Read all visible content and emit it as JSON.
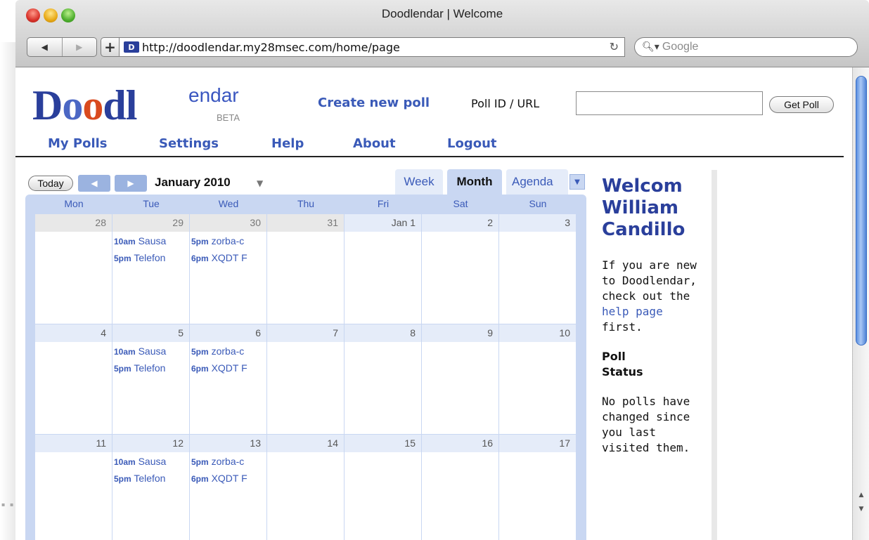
{
  "window": {
    "title": "Doodlendar | Welcome"
  },
  "toolbar": {
    "back_icon": "back-arrow-icon",
    "forward_icon": "forward-arrow-icon",
    "url": "http://doodlendar.my28msec.com/home/page",
    "search_placeholder": "Google"
  },
  "header": {
    "logo_main": "Doodl",
    "logo_small": "endar",
    "logo_beta": "BETA",
    "create_poll": "Create new poll",
    "poll_id_label": "Poll ID / URL",
    "poll_id_value": "",
    "get_poll": "Get Poll"
  },
  "nav": [
    "My Polls",
    "Settings",
    "Help",
    "About",
    "Logout"
  ],
  "calendar": {
    "today": "Today",
    "month_label": "January 2010",
    "views": [
      "Week",
      "Month",
      "Agenda"
    ],
    "active_view": "Month",
    "day_headers": [
      "Mon",
      "Tue",
      "Wed",
      "Thu",
      "Fri",
      "Sat",
      "Sun"
    ],
    "weeks": [
      {
        "days": [
          "28",
          "29",
          "30",
          "31",
          "Jan 1",
          "2",
          "3"
        ],
        "events": [
          {
            "day": 1,
            "time": "10am",
            "title": "Sausa"
          },
          {
            "day": 1,
            "time": "5pm",
            "title": "Telefon"
          },
          {
            "day": 2,
            "time": "5pm",
            "title": "zorba-c"
          },
          {
            "day": 2,
            "time": "6pm",
            "title": "XQDT F"
          }
        ]
      },
      {
        "days": [
          "4",
          "5",
          "6",
          "7",
          "8",
          "9",
          "10"
        ],
        "events": [
          {
            "day": 1,
            "time": "10am",
            "title": "Sausa"
          },
          {
            "day": 1,
            "time": "5pm",
            "title": "Telefon"
          },
          {
            "day": 2,
            "time": "5pm",
            "title": "zorba-c"
          },
          {
            "day": 2,
            "time": "6pm",
            "title": "XQDT F"
          }
        ]
      },
      {
        "days": [
          "11",
          "12",
          "13",
          "14",
          "15",
          "16",
          "17"
        ],
        "events": [
          {
            "day": 1,
            "time": "10am",
            "title": "Sausa"
          },
          {
            "day": 1,
            "time": "5pm",
            "title": "Telefon"
          },
          {
            "day": 2,
            "time": "5pm",
            "title": "zorba-c"
          },
          {
            "day": 2,
            "time": "6pm",
            "title": "XQDT F"
          }
        ]
      }
    ]
  },
  "welcome": {
    "heading_lines": [
      "Welcom",
      "William",
      "Candillo"
    ],
    "intro_before": "If you are new to Doodlendar, check out the",
    "help_link": "help page",
    "intro_after": "first.",
    "status_heading_lines": [
      "Poll",
      "Status"
    ],
    "status_text": "No polls have changed since you last visited them."
  },
  "colors": {
    "link": "#3a5ab8",
    "logo": "#2a3f9b",
    "calendar_frame": "#c9d7f2"
  }
}
